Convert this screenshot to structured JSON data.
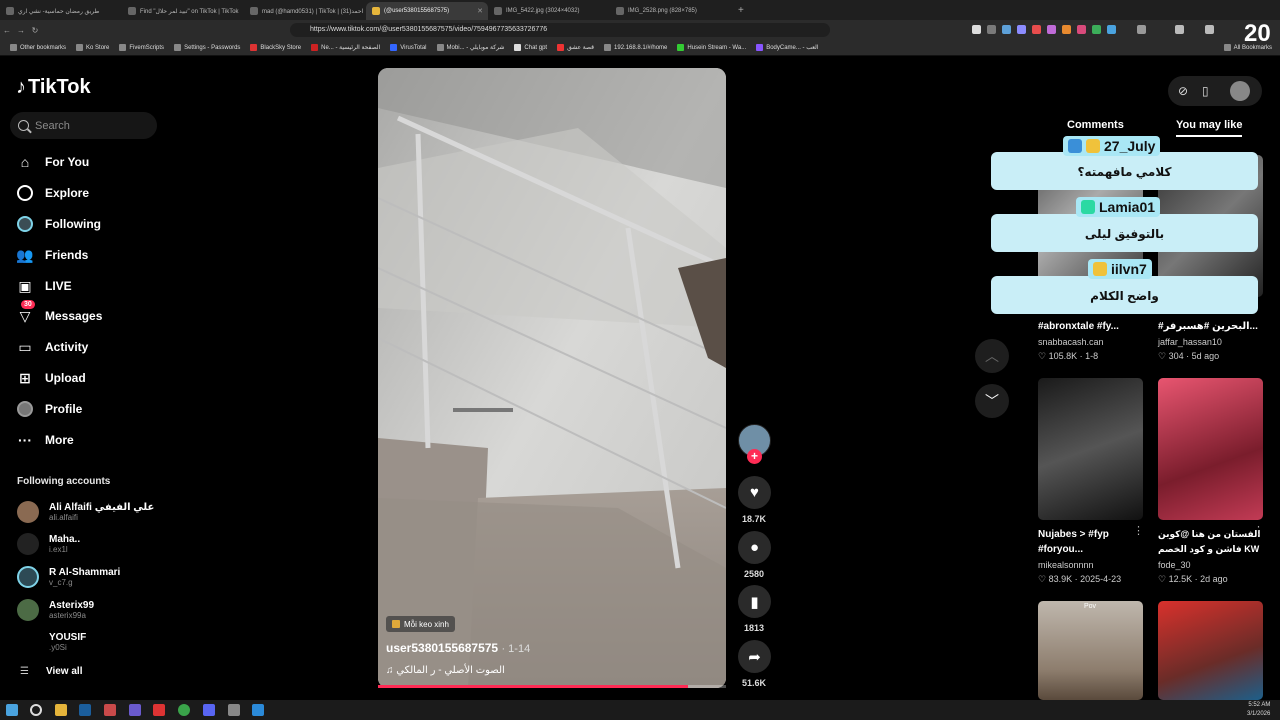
{
  "browser": {
    "tabs": [
      {
        "label": "طريق رمضان حماسية- نشي اري"
      },
      {
        "label": "Find \"تبيد لمر حلال\" on TikTok | TikTok"
      },
      {
        "label": "mad (@hamd0531) | TikTok | احمد(31)"
      },
      {
        "label": "(@user5380155687575)"
      },
      {
        "label": "IMG_5422.jpg (3024×4032)"
      },
      {
        "label": "IMG_2528.png (828×785)"
      }
    ],
    "url": "https://www.tiktok.com/@user5380155687575/video/7594967735633726776",
    "bookmarks": [
      "Other bookmarks",
      "Ko Store",
      "FivemScripts",
      "Settings - Passwords",
      "BlackSky Store",
      "Ne... - الصفحة الرئيسية",
      "VirusTotal",
      "Mobi... - شركة موبايلي",
      "Chat gpt",
      "قصة عشق",
      "192.168.8.1/#/home",
      "Husein Stream - Wa...",
      "BodyCame... - العب"
    ],
    "all_bookmarks": "All Bookmarks"
  },
  "sidebar": {
    "logo": "TikTok",
    "search_placeholder": "Search",
    "nav": [
      {
        "label": "For You",
        "icon": "home-icon"
      },
      {
        "label": "Explore",
        "icon": "compass-icon"
      },
      {
        "label": "Following",
        "icon": "following-icon"
      },
      {
        "label": "Friends",
        "icon": "friends-icon"
      },
      {
        "label": "LIVE",
        "icon": "live-icon"
      },
      {
        "label": "Messages",
        "icon": "messages-icon",
        "badge": "30"
      },
      {
        "label": "Activity",
        "icon": "activity-icon"
      },
      {
        "label": "Upload",
        "icon": "upload-icon"
      },
      {
        "label": "Profile",
        "icon": "profile-icon"
      },
      {
        "label": "More",
        "icon": "more-icon"
      }
    ],
    "following_title": "Following accounts",
    "following": [
      {
        "name": "Ali Alfaifi علي الفيفي",
        "handle": "ali.alfaifi"
      },
      {
        "name": "Maha..",
        "handle": "i.ex1l"
      },
      {
        "name": "R Al-Shammari",
        "handle": "v_c7.g"
      },
      {
        "name": "Asterix99",
        "handle": "asterix99a"
      },
      {
        "name": "YOUSIF",
        "handle": ".y0Si"
      }
    ],
    "view_all": "View all"
  },
  "video": {
    "tag": "Mỗi keo xinh",
    "username": "user5380155687575",
    "date": "· 1-14",
    "music": "♫  الصوت الأصلي - ر المالكي",
    "progress": 0.89,
    "likes": "18.7K",
    "comments": "2580",
    "saves": "1813",
    "shares": "51.6K"
  },
  "right_panel": {
    "tabs": [
      "Comments",
      "You may like"
    ],
    "cards": [
      {
        "title": "#abronxtale #fy...",
        "author": "snabbacash.can",
        "stats": "♡ 105.8K · 1-8"
      },
      {
        "title": "#البحرين #هسبرفر...",
        "author": "jaffar_hassan10",
        "stats": "♡ 304 · 5d ago"
      },
      {
        "title": "Nujabes > #fyp #foryou...",
        "author": "mikealsonnnn",
        "stats": "♡ 83.9K · 2025-4-23"
      },
      {
        "title": "الفستان من هنا @كوبن فاشن و كود الخصم KW",
        "author": "fode_30",
        "stats": "♡ 12.5K · 2d ago"
      }
    ],
    "thumb_text": "Pov"
  },
  "overlay": {
    "comments": [
      {
        "name": "27_July",
        "text": "كلامي مافهمته؟"
      },
      {
        "name": "Lamia01",
        "text": "بالتوفيق ليلى"
      },
      {
        "name": "iilvn7",
        "text": "واضح الكلام"
      }
    ],
    "counter": "20"
  },
  "taskbar": {
    "time": "5:52 AM",
    "date": "3/1/2026"
  },
  "colors": {
    "accent": "#fe2c55",
    "bubble": "#c9eef7"
  }
}
